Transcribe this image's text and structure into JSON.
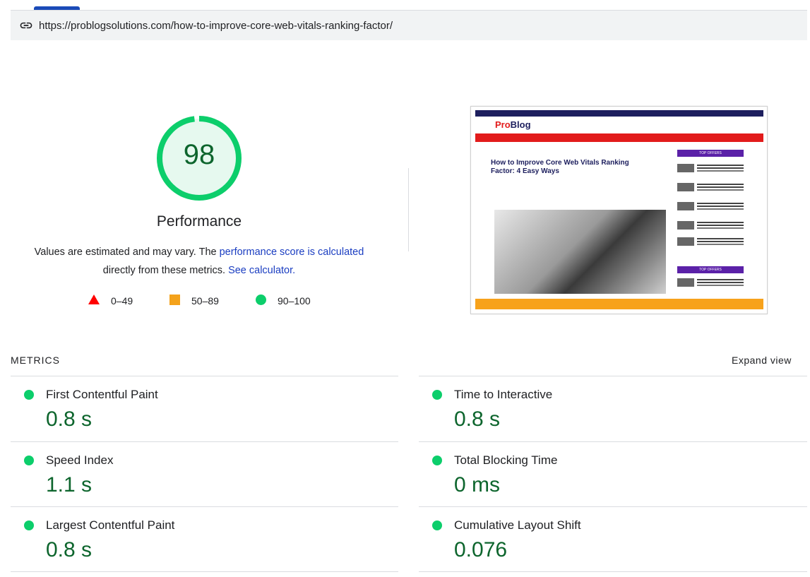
{
  "url": "https://problogsolutions.com/how-to-improve-core-web-vitals-ranking-factor/",
  "score": {
    "value": "98",
    "fraction": 0.98,
    "category": "Performance",
    "color": "#0cce6b"
  },
  "description": {
    "part1": "Values are estimated and may vary. The ",
    "link1": "performance score is calculated",
    "part2": "directly from these metrics. ",
    "link2": "See calculator."
  },
  "legend": [
    {
      "shape": "triangle",
      "color": "#ff0000",
      "label": "0–49"
    },
    {
      "shape": "square",
      "color": "#f4a21b",
      "label": "50–89"
    },
    {
      "shape": "circle",
      "color": "#0cce6b",
      "label": "90–100"
    }
  ],
  "metrics_header": "METRICS",
  "expand_label": "Expand view",
  "metrics": [
    {
      "name": "First Contentful Paint",
      "value": "0.8 s"
    },
    {
      "name": "Time to Interactive",
      "value": "0.8 s"
    },
    {
      "name": "Speed Index",
      "value": "1.1 s"
    },
    {
      "name": "Total Blocking Time",
      "value": "0 ms"
    },
    {
      "name": "Largest Contentful Paint",
      "value": "0.8 s"
    },
    {
      "name": "Cumulative Layout Shift",
      "value": "0.076"
    }
  ],
  "screenshot": {
    "logo_a": "Pro",
    "logo_b": "Blog",
    "article_title": "How to Improve Core Web Vitals Ranking Factor: 4 Easy Ways",
    "sidebar_heading_1": "TOP OFFERS",
    "sidebar_heading_2": "TOP OFFERS"
  },
  "colors": {
    "good": "#0cce6b",
    "good_text": "#0d652d",
    "link": "#1a3dc1"
  },
  "icons": {
    "url": "link-icon"
  }
}
